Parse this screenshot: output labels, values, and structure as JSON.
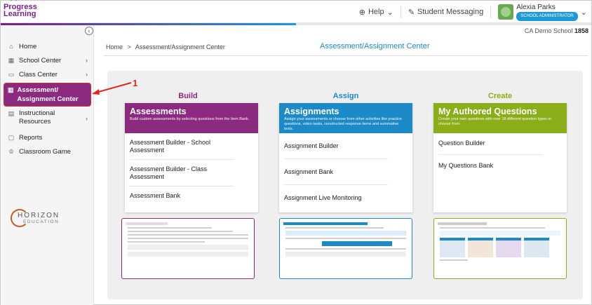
{
  "app": {
    "logo_line1": "Progress",
    "logo_line2": "Learning"
  },
  "topbar": {
    "help_label": "Help",
    "messaging_label": "Student Messaging",
    "user_name": "Alexia Parks",
    "user_role": "SCHOOL ADMINISTRATOR"
  },
  "school": {
    "name": "CA Demo School",
    "code": "1858"
  },
  "sidebar": {
    "items": [
      {
        "label": "Home",
        "icon": "home-icon",
        "chevron": false
      },
      {
        "label": "School Center",
        "icon": "school-icon",
        "chevron": true
      },
      {
        "label": "Class Center",
        "icon": "monitor-icon",
        "chevron": true
      },
      {
        "label": "Assessment/ Assignment Center",
        "icon": "book-icon",
        "chevron": false,
        "active": true
      },
      {
        "label": "Instructional Resources",
        "icon": "slides-icon",
        "chevron": true
      },
      {
        "label": "Reports",
        "icon": "report-icon",
        "chevron": false
      },
      {
        "label": "Classroom Game",
        "icon": "game-icon",
        "chevron": false
      }
    ],
    "partner_logo_line1": "HORIZON",
    "partner_logo_line2": "EDUCATION"
  },
  "breadcrumb": {
    "home": "Home",
    "separator": ">",
    "current": "Assessment/Assignment Center"
  },
  "page_title": "Assessment/Assignment Center",
  "annotation": {
    "number": "1",
    "color": "#e0261b"
  },
  "columns": [
    {
      "title": "Build",
      "color": "#8b2a7e",
      "title_color": "#8b2a7e",
      "card_title": "Assessments",
      "card_desc": "Build custom assessments by selecting questions from the Item Bank.",
      "links": [
        "Assessment Builder - School Assessment",
        "Assessment Builder - Class Assessment",
        "Assessment Bank"
      ]
    },
    {
      "title": "Assign",
      "color": "#1b8ac6",
      "title_color": "#1b8ac6",
      "card_title": "Assignments",
      "card_desc": "Assign your assessments or choose from other activities like practice questions, video tasks, constructed response items and summative tests.",
      "links": [
        "Assignment Builder",
        "Assignment Bank",
        "Assignment Live Monitoring"
      ]
    },
    {
      "title": "Create",
      "color": "#8aad1a",
      "title_color": "#8aad1a",
      "card_title": "My Authored Questions",
      "card_desc": "Create your own questions with over 18 different question types to choose from.",
      "links": [
        "Question Builder",
        "My Questions Bank"
      ]
    }
  ]
}
